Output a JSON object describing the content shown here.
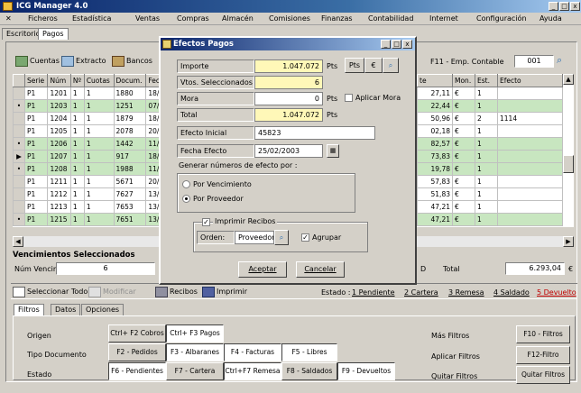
{
  "window": {
    "title": "ICG Manager 4.0",
    "controls": [
      "_",
      "ð",
      "X"
    ]
  },
  "menu": [
    "Ficheros",
    "Estadística",
    "Ventas",
    "Compras",
    "Almacén",
    "Comisiones",
    "Finanzas",
    "Contabilidad",
    "Internet",
    "Configuración",
    "Ayuda"
  ],
  "top_tabs": [
    "Escritorio",
    "Pagos"
  ],
  "toolbar": {
    "cuentas": "Cuentas",
    "extracto": "Extracto",
    "bancos": "Bancos",
    "f11_label": "F11 - Emp. Contable",
    "empresa_value": "001"
  },
  "grid_left": {
    "headers": [
      "Serie",
      "Núm",
      "Nº",
      "Cuotas",
      "Docum.",
      "Fech"
    ],
    "rows": [
      {
        "mark": "",
        "serie": "P1",
        "num": "1201",
        "n": "1",
        "cuotas": "1",
        "docum": "1880",
        "fech": "18/0",
        "color": "white"
      },
      {
        "mark": "•",
        "serie": "P1",
        "num": "1203",
        "n": "1",
        "cuotas": "1",
        "docum": "1251",
        "fech": "07/0",
        "color": "green"
      },
      {
        "mark": "",
        "serie": "P1",
        "num": "1204",
        "n": "1",
        "cuotas": "1",
        "docum": "1879",
        "fech": "18/0",
        "color": "white"
      },
      {
        "mark": "",
        "serie": "P1",
        "num": "1205",
        "n": "1",
        "cuotas": "1",
        "docum": "2078",
        "fech": "20/0",
        "color": "white"
      },
      {
        "mark": "•",
        "serie": "P1",
        "num": "1206",
        "n": "1",
        "cuotas": "1",
        "docum": "1442",
        "fech": "11/0",
        "color": "green"
      },
      {
        "mark": "▶",
        "serie": "P1",
        "num": "1207",
        "n": "1",
        "cuotas": "1",
        "docum": "917",
        "fech": "18/0",
        "color": "green"
      },
      {
        "mark": "•",
        "serie": "P1",
        "num": "1208",
        "n": "1",
        "cuotas": "1",
        "docum": "1988",
        "fech": "11/0",
        "color": "green"
      },
      {
        "mark": "",
        "serie": "P1",
        "num": "1211",
        "n": "1",
        "cuotas": "1",
        "docum": "5671",
        "fech": "20/0",
        "color": "white"
      },
      {
        "mark": "",
        "serie": "P1",
        "num": "1212",
        "n": "1",
        "cuotas": "1",
        "docum": "7627",
        "fech": "13/0",
        "color": "white"
      },
      {
        "mark": "",
        "serie": "P1",
        "num": "1213",
        "n": "1",
        "cuotas": "1",
        "docum": "7653",
        "fech": "13/0",
        "color": "white"
      },
      {
        "mark": "•",
        "serie": "P1",
        "num": "1215",
        "n": "1",
        "cuotas": "1",
        "docum": "7651",
        "fech": "13/0",
        "color": "green"
      }
    ]
  },
  "grid_right": {
    "headers": [
      "te",
      "Mon.",
      "Est.",
      "Efecto"
    ],
    "rows": [
      {
        "te": "27,11",
        "mon": "€",
        "est": "1",
        "efecto": "",
        "color": "white"
      },
      {
        "te": "22,44",
        "mon": "€",
        "est": "1",
        "efecto": "",
        "color": "green"
      },
      {
        "te": "50,96",
        "mon": "€",
        "est": "2",
        "efecto": "1114",
        "color": "white"
      },
      {
        "te": "02,18",
        "mon": "€",
        "est": "1",
        "efecto": "",
        "color": "white"
      },
      {
        "te": "82,57",
        "mon": "€",
        "est": "1",
        "efecto": "",
        "color": "green"
      },
      {
        "te": "73,83",
        "mon": "€",
        "est": "1",
        "efecto": "",
        "color": "green"
      },
      {
        "te": "19,78",
        "mon": "€",
        "est": "1",
        "efecto": "",
        "color": "green"
      },
      {
        "te": "57,83",
        "mon": "€",
        "est": "1",
        "efecto": "",
        "color": "white"
      },
      {
        "te": "51,83",
        "mon": "€",
        "est": "1",
        "efecto": "",
        "color": "white"
      },
      {
        "te": "47,21",
        "mon": "€",
        "est": "1",
        "efecto": "",
        "color": "white"
      },
      {
        "te": "47,21",
        "mon": "€",
        "est": "1",
        "efecto": "",
        "color": "green"
      }
    ]
  },
  "vencimientos": {
    "title": "Vencimientos Seleccionados",
    "num_label": "Núm Vencim.",
    "num_value": "6",
    "d_label": "D",
    "total_label": "Total",
    "total_value": "6.293,04",
    "currency": "€"
  },
  "actions": {
    "select_all": "Seleccionar Todo",
    "modificar": "Modificar",
    "recibos": "Recibos",
    "imprimir": "Imprimir",
    "estado_label": "Estado :",
    "states": [
      "1 Pendiente",
      "2 Cartera",
      "3 Remesa",
      "4 Saldado",
      "5 Devuelto"
    ]
  },
  "bottom_tabs": [
    "Filtros",
    "Datos",
    "Opciones"
  ],
  "filters": {
    "origen": "Origen",
    "tipo": "Tipo Documento",
    "estado": "Estado",
    "row1": [
      "Ctrl+ F2 Cobros",
      "Ctrl+ F3 Pagos"
    ],
    "row2": [
      "F2 - Pedidos",
      "F3 - Albaranes",
      "F4 - Facturas",
      "F5 - Libres"
    ],
    "row3": [
      "F6 - Pendientes",
      "F7 - Cartera",
      "Ctrl+F7 Remesa",
      "F8 - Saldados",
      "F9 - Devueltos"
    ],
    "mas": "Más Filtros",
    "aplicar": "Aplicar Filtros",
    "quitar": "Quitar Filtros",
    "f10": "F10 - Filtros",
    "f12": "F12-Filtro",
    "quitar_btn": "Quitar Filtros"
  },
  "dialog": {
    "title": "Efectos Pagos",
    "importe_label": "Importe",
    "importe_value": "1.047.072",
    "pts": "Pts",
    "pts_btn": "Pts",
    "euro_btn": "€",
    "vtos_label": "Vtos. Seleccionados",
    "vtos_value": "6",
    "mora_label": "Mora",
    "mora_value": "0",
    "aplicar_mora": "Aplicar Mora",
    "total_label": "Total",
    "total_value": "1.047.072",
    "efecto_label": "Efecto Inicial",
    "efecto_value": "45823",
    "fecha_label": "Fecha Efecto",
    "fecha_value": "25/02/2003",
    "generar_label": "Generar números de efecto por :",
    "opt_venc": "Por Vencimiento",
    "opt_prov": "Por Proveedor",
    "imprimir_recibos": "Imprimir Recibos",
    "orden_label": "Orden:",
    "orden_value": "Proveedor",
    "agrupar": "Agrupar",
    "aceptar": "Aceptar",
    "cancelar": "Cancelar"
  }
}
